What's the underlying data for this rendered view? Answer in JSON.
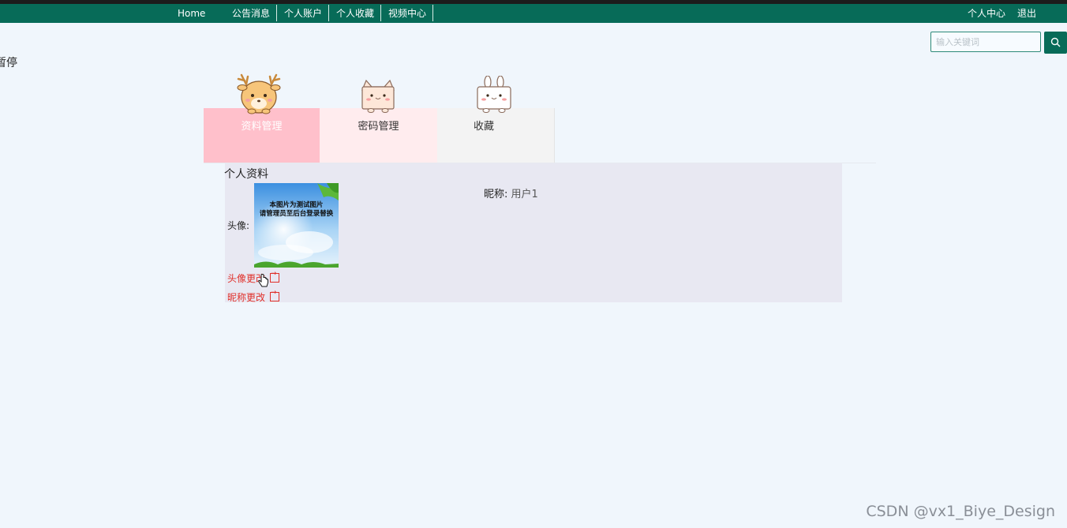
{
  "nav": {
    "home": "Home",
    "announcements": "公告消息",
    "account": "个人账户",
    "favorites": "个人收藏",
    "video_center": "视频中心",
    "user_center": "个人中心",
    "logout": "退出"
  },
  "search": {
    "placeholder": "输入关键词"
  },
  "marquee": "暂停",
  "tabs": [
    {
      "label": "资料管理",
      "mascot": "deer-icon"
    },
    {
      "label": "密码管理",
      "mascot": "cat-icon"
    },
    {
      "label": "收藏",
      "mascot": "rabbit-icon"
    }
  ],
  "profile": {
    "title": "个人资料",
    "avatar_label": "头像:",
    "avatar_caption_line1": "本图片为测试图片",
    "avatar_caption_line2": "请管理员至后台登录替换",
    "nickname_label": "昵称:",
    "nickname_value": "用户1",
    "change_avatar": "头像更改",
    "change_nickname": "昵称更改"
  },
  "watermark": "CSDN @vx1_Biye_Design",
  "colors": {
    "nav_bg": "#076b58",
    "tab_active": "#ffc0cb",
    "link_red": "#e0302a"
  }
}
